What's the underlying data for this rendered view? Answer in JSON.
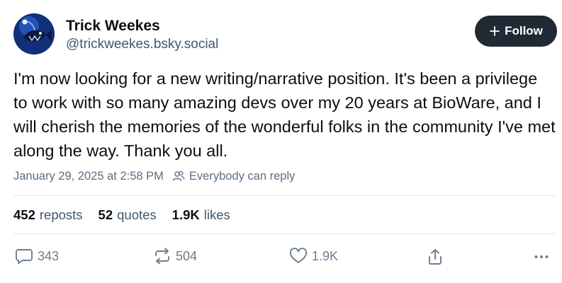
{
  "author": {
    "display_name": "Trick Weekes",
    "handle": "@trickweekes.bsky.social",
    "avatar_icon": "anglerfish-avatar"
  },
  "follow_button": {
    "label": "Follow",
    "icon": "plus-icon"
  },
  "post": {
    "text": "I'm now looking for a new writing/narrative position. It's been a privilege to work with so many amazing devs over my 20 years at BioWare, and I will cherish the memories of the wonderful folks in the community I've met along the way. Thank you all.",
    "timestamp": "January 29, 2025 at 2:58 PM",
    "reply_setting": "Everybody can reply"
  },
  "stats": {
    "reposts_count": "452",
    "reposts_label": "reposts",
    "quotes_count": "52",
    "quotes_label": "quotes",
    "likes_count": "1.9K",
    "likes_label": "likes"
  },
  "actions": {
    "reply_count": "343",
    "repost_count": "504",
    "like_count": "1.9K"
  },
  "colors": {
    "text": "#0b0f14",
    "muted": "#42576c",
    "follow_bg": "#202a35",
    "divider": "#e3e8ed"
  }
}
